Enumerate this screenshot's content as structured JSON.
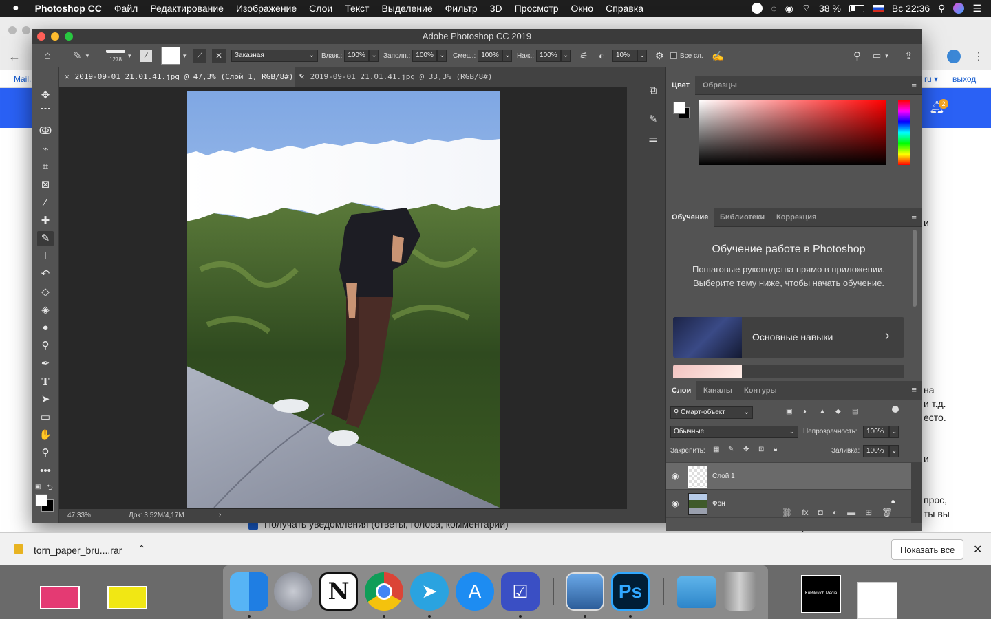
{
  "menubar": {
    "apple_icon": "apple-icon",
    "app_name": "Photoshop CC",
    "items": [
      "Файл",
      "Редактирование",
      "Изображение",
      "Слои",
      "Текст",
      "Выделение",
      "Фильтр",
      "3D",
      "Просмотр",
      "Окно",
      "Справка"
    ],
    "battery": "38 %",
    "clock": "Вс 22:36"
  },
  "browser": {
    "left_link": "Mail.",
    "right_link1": "ru ▾",
    "right_link2": "выход",
    "badge_count": "2",
    "side_fragments": [
      "и",
      "на",
      "и т.д.",
      "есто.",
      "и",
      "прос,",
      "ты вы",
      "получите."
    ],
    "checkbox_label": "Получать уведомления (ответы, голоса, комментарии)"
  },
  "photoshop": {
    "title": "Adobe Photoshop CC 2019",
    "options": {
      "brush_size": "1278",
      "preset": "Заказная",
      "wet_label": "Влаж.:",
      "wet_value": "100%",
      "load_label": "Заполн.:",
      "load_value": "100%",
      "mix_label": "Смеш.:",
      "mix_value": "100%",
      "flow_label": "Наж.:",
      "flow_value": "100%",
      "smooth_value": "10%",
      "all_layers": "Все сл."
    },
    "tabs": [
      {
        "label": "2019-09-01 21.01.41.jpg @ 47,3% (Слой 1, RGB/8#) *",
        "active": true
      },
      {
        "label": "2019-09-01 21.01.41.jpg @ 33,3% (RGB/8#)",
        "active": false
      }
    ],
    "status": {
      "zoom": "47,33%",
      "doc": "Док: 3,52M/4,17M"
    },
    "color_panel": {
      "tabs": [
        "Цвет",
        "Образцы"
      ]
    },
    "learn_panel": {
      "tabs": [
        "Обучение",
        "Библиотеки",
        "Коррекция"
      ],
      "title": "Обучение работе в Photoshop",
      "description": "Пошаговые руководства прямо в приложении. Выберите тему ниже, чтобы начать обучение.",
      "card_label": "Основные навыки"
    },
    "layers_panel": {
      "tabs": [
        "Слои",
        "Каналы",
        "Контуры"
      ],
      "filter": "Смарт-объект",
      "blend_mode": "Обычные",
      "opacity_label": "Непрозрачность:",
      "opacity_value": "100%",
      "lock_label": "Закрепить:",
      "fill_label": "Заливка:",
      "fill_value": "100%",
      "layers": [
        {
          "name": "Слой 1",
          "selected": true
        },
        {
          "name": "Фон",
          "selected": false
        }
      ]
    }
  },
  "downloads": {
    "file": "torn_paper_bru....rar",
    "show_all": "Показать все"
  },
  "dock": {
    "apps": [
      "Finder",
      "Launchpad",
      "Notion",
      "Chrome",
      "Telegram",
      "App Store",
      "Tasks",
      "Preview",
      "Photoshop",
      "Files",
      "Trash"
    ],
    "ps_label": "Ps",
    "notion_label": "N",
    "desktop_label": "KuRilovich Media"
  }
}
